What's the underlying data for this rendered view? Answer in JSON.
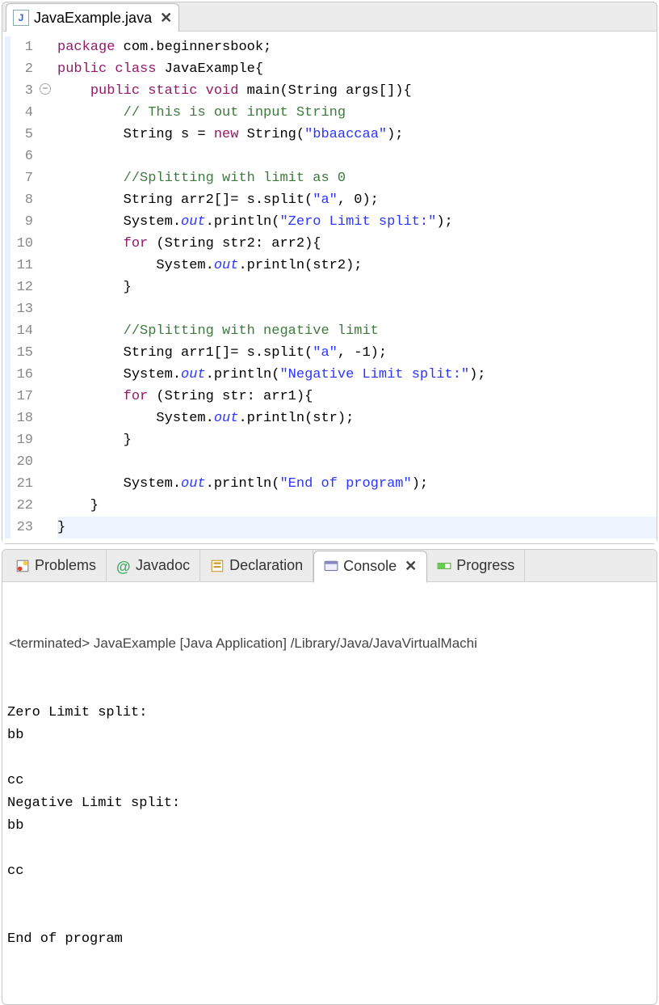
{
  "editor": {
    "tab": {
      "filename": "JavaExample.java",
      "icon": "J"
    },
    "lines": [
      {
        "n": 1,
        "html": "<span class='kw'>package</span> com.beginnersbook;"
      },
      {
        "n": 2,
        "html": "<span class='kw'>public</span> <span class='kw'>class</span> JavaExample{"
      },
      {
        "n": 3,
        "html": "    <span class='kw'>public</span> <span class='kw'>static</span> <span class='kw'>void</span> main(String args[]){",
        "fold": true
      },
      {
        "n": 4,
        "html": "        <span class='cm'>// This is out input String</span>"
      },
      {
        "n": 5,
        "html": "        String s = <span class='kw'>new</span> String(<span class='str'>\"bbaaccaa\"</span>);"
      },
      {
        "n": 6,
        "html": ""
      },
      {
        "n": 7,
        "html": "        <span class='cm'>//Splitting with limit as 0</span>"
      },
      {
        "n": 8,
        "html": "        String arr2[]= s.split(<span class='str'>\"a\"</span>, 0);"
      },
      {
        "n": 9,
        "html": "        System.<span class='fld'>out</span>.println(<span class='str'>\"Zero Limit split:\"</span>);"
      },
      {
        "n": 10,
        "html": "        <span class='kw'>for</span> (String str2: arr2){"
      },
      {
        "n": 11,
        "html": "            System.<span class='fld'>out</span>.println(str2);"
      },
      {
        "n": 12,
        "html": "        }"
      },
      {
        "n": 13,
        "html": ""
      },
      {
        "n": 14,
        "html": "        <span class='cm'>//Splitting with negative limit</span>"
      },
      {
        "n": 15,
        "html": "        String arr1[]= s.split(<span class='str'>\"a\"</span>, -1);"
      },
      {
        "n": 16,
        "html": "        System.<span class='fld'>out</span>.println(<span class='str'>\"Negative Limit split:\"</span>);"
      },
      {
        "n": 17,
        "html": "        <span class='kw'>for</span> (String str: arr1){"
      },
      {
        "n": 18,
        "html": "            System.<span class='fld'>out</span>.println(str);"
      },
      {
        "n": 19,
        "html": "        }"
      },
      {
        "n": 20,
        "html": ""
      },
      {
        "n": 21,
        "html": "        System.<span class='fld'>out</span>.println(<span class='str'>\"End of program\"</span>);"
      },
      {
        "n": 22,
        "html": "    }"
      },
      {
        "n": 23,
        "html": "}",
        "highlight": true
      }
    ]
  },
  "bottomTabs": {
    "items": [
      {
        "label": "Problems",
        "icon": "problems"
      },
      {
        "label": "Javadoc",
        "icon": "javadoc"
      },
      {
        "label": "Declaration",
        "icon": "declaration"
      },
      {
        "label": "Console",
        "icon": "console",
        "active": true
      },
      {
        "label": "Progress",
        "icon": "progress"
      }
    ]
  },
  "console": {
    "title": "<terminated> JavaExample [Java Application] /Library/Java/JavaVirtualMachi",
    "output": "Zero Limit split:\nbb\n\ncc\nNegative Limit split:\nbb\n\ncc\n\n\nEnd of program"
  }
}
